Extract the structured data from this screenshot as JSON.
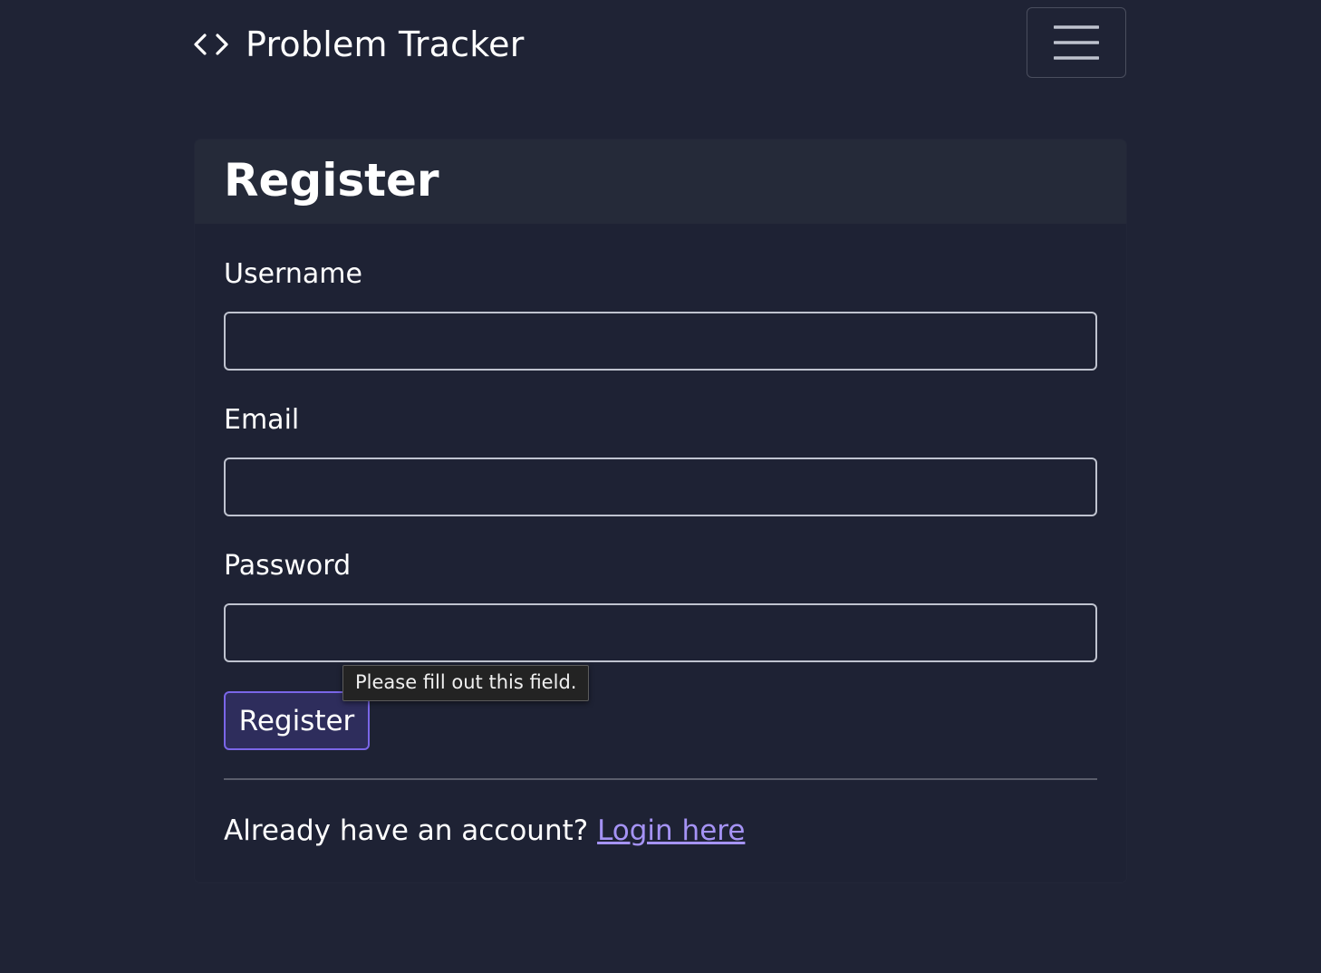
{
  "navbar": {
    "brand_icon": "code-brackets-icon",
    "brand_text": "Problem Tracker",
    "menu_icon": "hamburger-menu-icon"
  },
  "form": {
    "title": "Register",
    "fields": [
      {
        "label": "Username",
        "value": "",
        "type": "text"
      },
      {
        "label": "Email",
        "value": "",
        "type": "email"
      },
      {
        "label": "Password",
        "value": "",
        "type": "password"
      }
    ],
    "submit_label": "Register",
    "validation_tooltip": "Please fill out this field.",
    "footer_prompt": "Already have an account?",
    "login_link_label": "Login here"
  },
  "colors": {
    "background": "#1f2335",
    "card_header": "#252a39",
    "button_bg": "#2e2d5c",
    "button_border": "#7a66e8",
    "link": "#a593f5"
  }
}
